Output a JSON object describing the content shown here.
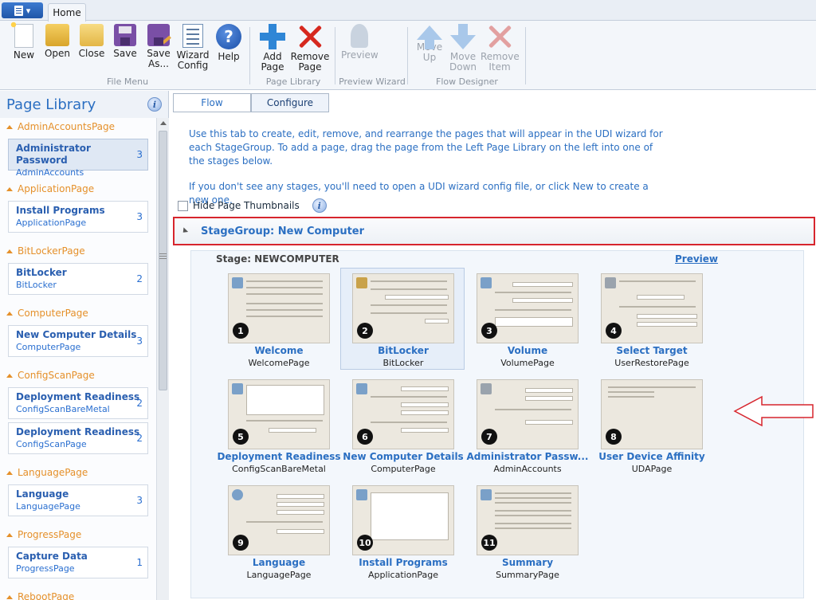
{
  "app": {
    "home_tab": "Home"
  },
  "ribbon": {
    "file_menu": {
      "label": "File Menu",
      "buttons": [
        {
          "label": "New",
          "icon": "new-file-icon"
        },
        {
          "label": "Open",
          "icon": "open-folder-icon"
        },
        {
          "label": "Close",
          "icon": "close-folder-icon"
        },
        {
          "label": "Save",
          "icon": "save-icon"
        },
        {
          "label": "Save\nAs...",
          "icon": "save-as-icon"
        },
        {
          "label": "Wizard\nConfig",
          "icon": "wizard-config-icon"
        },
        {
          "label": "Help",
          "icon": "help-icon"
        }
      ]
    },
    "page_library": {
      "label": "Page Library",
      "buttons": [
        {
          "label": "Add\nPage",
          "icon": "add-icon"
        },
        {
          "label": "Remove\nPage",
          "icon": "remove-icon"
        }
      ]
    },
    "preview_wizard": {
      "label": "Preview Wizard",
      "buttons": [
        {
          "label": "Preview",
          "icon": "preview-icon",
          "enabled": false
        }
      ]
    },
    "flow_designer": {
      "label": "Flow Designer",
      "buttons": [
        {
          "label": "Move\nUp",
          "icon": "move-up-icon",
          "enabled": false
        },
        {
          "label": "Move\nDown",
          "icon": "move-down-icon",
          "enabled": false
        },
        {
          "label": "Remove\nItem",
          "icon": "remove-item-icon",
          "enabled": false
        }
      ]
    }
  },
  "library": {
    "title": "Page Library",
    "categories": [
      {
        "name": "AdminAccountsPage",
        "items": [
          {
            "name": "Administrator Password",
            "page": "AdminAccounts",
            "count": "3",
            "selected": true
          }
        ]
      },
      {
        "name": "ApplicationPage",
        "items": [
          {
            "name": "Install Programs",
            "page": "ApplicationPage",
            "count": "3"
          }
        ]
      },
      {
        "name": "BitLockerPage",
        "items": [
          {
            "name": "BitLocker",
            "page": "BitLocker",
            "count": "2"
          }
        ]
      },
      {
        "name": "ComputerPage",
        "items": [
          {
            "name": "New Computer Details",
            "page": "ComputerPage",
            "count": "3"
          }
        ]
      },
      {
        "name": "ConfigScanPage",
        "items": [
          {
            "name": "Deployment Readiness",
            "page": "ConfigScanBareMetal",
            "count": "2"
          },
          {
            "name": "Deployment Readiness",
            "page": "ConfigScanPage",
            "count": "2"
          }
        ]
      },
      {
        "name": "LanguagePage",
        "items": [
          {
            "name": "Language",
            "page": "LanguagePage",
            "count": "3"
          }
        ]
      },
      {
        "name": "ProgressPage",
        "items": [
          {
            "name": "Capture Data",
            "page": "ProgressPage",
            "count": "1"
          }
        ]
      },
      {
        "name": "RebootPage",
        "items": []
      }
    ]
  },
  "main": {
    "tabs": [
      {
        "label": "Flow",
        "active": false
      },
      {
        "label": "Configure",
        "active": true
      }
    ],
    "intro": [
      "Use this tab to create, edit, remove, and rearrange the pages that will appear in the UDI wizard for each StageGroup. To add a page, drag the page from the Left Page Library on the left into one of the stages below.",
      "If you don't see any stages, you'll need to open a UDI wizard config file, or click New to create a new one."
    ],
    "hide_thumbnails_label": "Hide Page Thumbnails",
    "stage_group_title": "StageGroup: New Computer",
    "stage_label": "Stage: NEWCOMPUTER",
    "preview_link": "Preview",
    "cards": [
      {
        "num": "1",
        "title": "Welcome",
        "page": "WelcomePage"
      },
      {
        "num": "2",
        "title": "BitLocker",
        "page": "BitLocker",
        "selected": true
      },
      {
        "num": "3",
        "title": "Volume",
        "page": "VolumePage"
      },
      {
        "num": "4",
        "title": "Select Target",
        "page": "UserRestorePage"
      },
      {
        "num": "5",
        "title": "Deployment Readiness",
        "page": "ConfigScanBareMetal"
      },
      {
        "num": "6",
        "title": "New Computer Details",
        "page": "ComputerPage"
      },
      {
        "num": "7",
        "title": "Administrator Passw...",
        "page": "AdminAccounts"
      },
      {
        "num": "8",
        "title": "User Device Affinity",
        "page": "UDAPage"
      },
      {
        "num": "9",
        "title": "Language",
        "page": "LanguagePage"
      },
      {
        "num": "10",
        "title": "Install Programs",
        "page": "ApplicationPage"
      },
      {
        "num": "11",
        "title": "Summary",
        "page": "SummaryPage"
      }
    ]
  },
  "colors": {
    "accent": "#2b6fc2",
    "category": "#e5902a",
    "highlight_border": "#d7252d"
  }
}
